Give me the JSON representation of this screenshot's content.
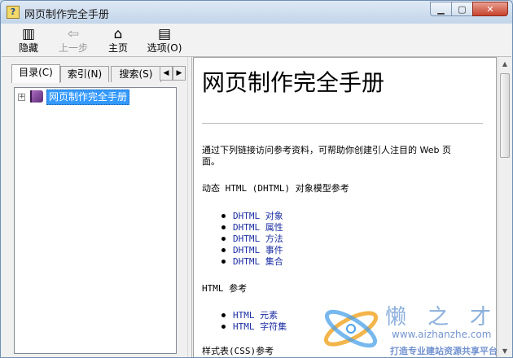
{
  "window": {
    "title": "网页制作完全手册",
    "buttons": {
      "minimize": "▁",
      "maximize": "▢",
      "close": "✕"
    }
  },
  "toolbar": {
    "hide": {
      "label": "隐藏",
      "icon": "hide-panel-icon",
      "glyph": "▥"
    },
    "back": {
      "label": "上一步",
      "icon": "back-arrow-icon",
      "glyph": "⇦"
    },
    "home": {
      "label": "主页",
      "icon": "home-icon",
      "glyph": "⌂"
    },
    "options": {
      "label": "选项(O)",
      "icon": "options-icon",
      "glyph": "▤"
    }
  },
  "nav_tabs": [
    {
      "label": "目录(C)",
      "active": true
    },
    {
      "label": "索引(N)",
      "active": false
    },
    {
      "label": "搜索(S)",
      "active": false
    }
  ],
  "tab_scroll": {
    "left": "◀",
    "right": "▶"
  },
  "tree": {
    "expander": "+",
    "items": [
      {
        "label": "网页制作完全手册",
        "selected": true
      }
    ]
  },
  "document": {
    "title": "网页制作完全手册",
    "intro_line1": "通过下列链接访问参考资料，可帮助你创建引人注目的 Web 页",
    "intro_line2": "面。",
    "dhtml_heading": "动态 HTML (DHTML) 对象模型参考",
    "dhtml_links": [
      "DHTML 对象",
      "DHTML 属性",
      "DHTML 方法",
      "DHTML 事件",
      "DHTML 集合"
    ],
    "html_heading": "HTML 参考",
    "html_links": [
      "HTML 元素",
      "HTML 字符集"
    ],
    "css_heading_partial": "样式表(CSS)参考"
  },
  "scrollbar": {
    "up": "▲",
    "down": "▼"
  },
  "watermark": {
    "name": "懒之才",
    "url": "www.aizhanzhe.com",
    "slogan": "打造专业建站资源共享平台"
  },
  "colors": {
    "selection": "#3399ff",
    "link": "#1b2ea3",
    "close_button": "#c7432c"
  }
}
